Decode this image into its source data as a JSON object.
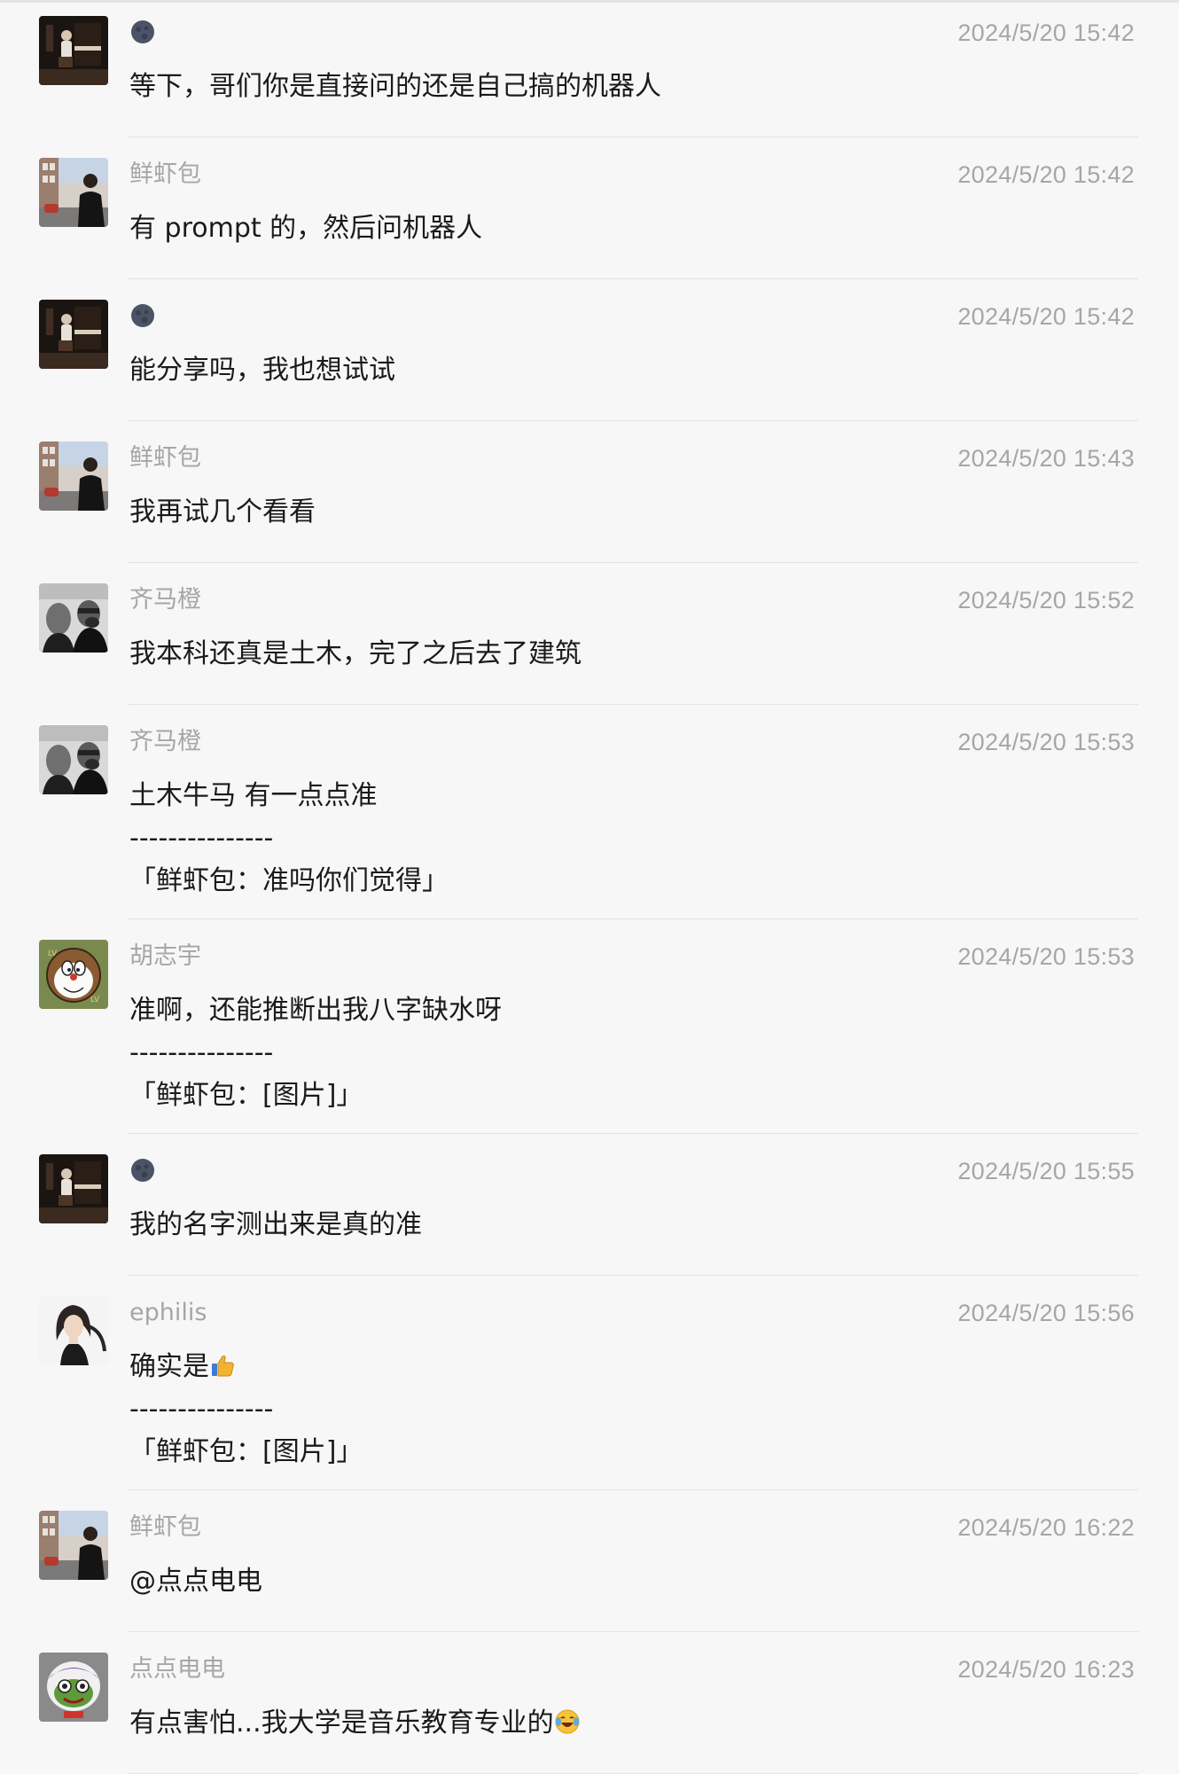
{
  "messages": [
    {
      "avatar": "piano-avatar",
      "sender": "🌑",
      "time": "2024/5/20 15:42",
      "lines": [
        "等下，哥们你是直接问的还是自己搞的机器人"
      ]
    },
    {
      "avatar": "street-avatar",
      "sender": "鲜虾包",
      "time": "2024/5/20 15:42",
      "lines": [
        "有 prompt 的，然后问机器人"
      ]
    },
    {
      "avatar": "piano-avatar",
      "sender": "🌑",
      "time": "2024/5/20 15:42",
      "lines": [
        "能分享吗，我也想试试"
      ]
    },
    {
      "avatar": "street-avatar",
      "sender": "鲜虾包",
      "time": "2024/5/20 15:43",
      "lines": [
        "我再试几个看看"
      ]
    },
    {
      "avatar": "bw-photo-avatar",
      "sender": "齐马橙",
      "time": "2024/5/20 15:52",
      "lines": [
        "我本科还真是土木，完了之后去了建筑"
      ]
    },
    {
      "avatar": "bw-photo-avatar",
      "sender": "齐马橙",
      "time": "2024/5/20 15:53",
      "lines": [
        "土木牛马 有一点点准",
        "---------------",
        "「鲜虾包：准吗你们觉得」"
      ]
    },
    {
      "avatar": "doraemon-avatar",
      "sender": "胡志宇",
      "time": "2024/5/20 15:53",
      "lines": [
        "准啊，还能推断出我八字缺水呀",
        "---------------",
        "「鲜虾包：[图片]」"
      ]
    },
    {
      "avatar": "piano-avatar",
      "sender": "🌑",
      "time": "2024/5/20 15:55",
      "lines": [
        "我的名字测出来是真的准"
      ]
    },
    {
      "avatar": "girl-avatar",
      "sender": "ephilis",
      "time": "2024/5/20 15:56",
      "lines": [
        "确实是",
        "---------------",
        "「鲜虾包：[图片]」"
      ],
      "first_line_emoji": "thumbs-up-icon"
    },
    {
      "avatar": "street-avatar",
      "sender": "鲜虾包",
      "time": "2024/5/20 16:22",
      "lines": [
        "@点点电电"
      ]
    },
    {
      "avatar": "frog-avatar",
      "sender": "点点电电",
      "time": "2024/5/20 16:23",
      "lines": [
        "有点害怕...我大学是音乐教育专业的"
      ],
      "first_line_emoji": "laughing-tears-icon"
    }
  ]
}
